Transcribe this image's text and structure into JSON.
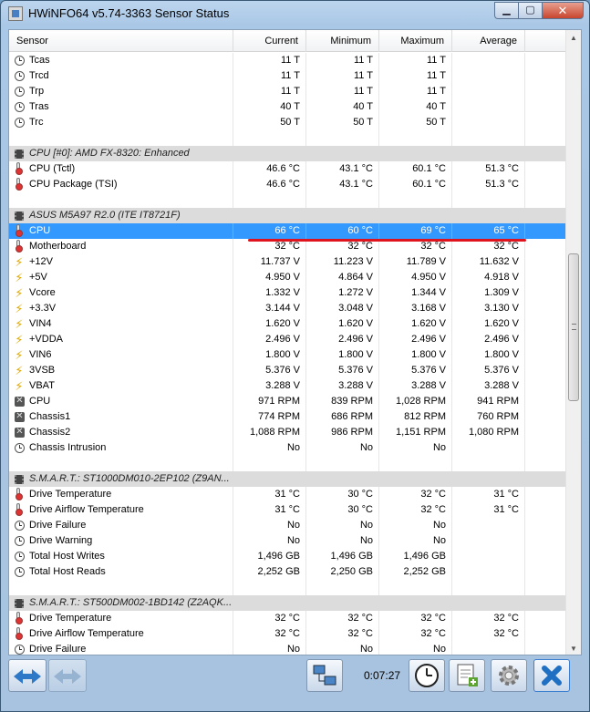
{
  "window": {
    "title": "HWiNFO64 v5.74-3363 Sensor Status",
    "caption_buttons": [
      "minimize",
      "maximize",
      "close"
    ]
  },
  "columns": [
    "Sensor",
    "Current",
    "Minimum",
    "Maximum",
    "Average"
  ],
  "rows": [
    {
      "type": "item",
      "icon": "clock-icon",
      "name": "Tcas",
      "cur": "11 T",
      "min": "11 T",
      "max": "11 T",
      "avg": ""
    },
    {
      "type": "item",
      "icon": "clock-icon",
      "name": "Trcd",
      "cur": "11 T",
      "min": "11 T",
      "max": "11 T",
      "avg": ""
    },
    {
      "type": "item",
      "icon": "clock-icon",
      "name": "Trp",
      "cur": "11 T",
      "min": "11 T",
      "max": "11 T",
      "avg": ""
    },
    {
      "type": "item",
      "icon": "clock-icon",
      "name": "Tras",
      "cur": "40 T",
      "min": "40 T",
      "max": "40 T",
      "avg": ""
    },
    {
      "type": "item",
      "icon": "clock-icon",
      "name": "Trc",
      "cur": "50 T",
      "min": "50 T",
      "max": "50 T",
      "avg": ""
    },
    {
      "type": "blank"
    },
    {
      "type": "group",
      "icon": "chip-icon",
      "name": "CPU [#0]: AMD FX-8320: Enhanced"
    },
    {
      "type": "item",
      "icon": "thermometer-icon",
      "name": "CPU (Tctl)",
      "cur": "46.6 °C",
      "min": "43.1 °C",
      "max": "60.1 °C",
      "avg": "51.3 °C"
    },
    {
      "type": "item",
      "icon": "thermometer-icon",
      "name": "CPU Package (TSI)",
      "cur": "46.6 °C",
      "min": "43.1 °C",
      "max": "60.1 °C",
      "avg": "51.3 °C"
    },
    {
      "type": "blank"
    },
    {
      "type": "group",
      "icon": "chip-icon",
      "name": "ASUS M5A97 R2.0 (ITE IT8721F)"
    },
    {
      "type": "item",
      "icon": "thermometer-icon",
      "name": "CPU",
      "cur": "66 °C",
      "min": "60 °C",
      "max": "69 °C",
      "avg": "65 °C",
      "selected": true
    },
    {
      "type": "item",
      "icon": "thermometer-icon",
      "name": "Motherboard",
      "cur": "32 °C",
      "min": "32 °C",
      "max": "32 °C",
      "avg": "32 °C"
    },
    {
      "type": "item",
      "icon": "bolt-icon",
      "name": "+12V",
      "cur": "11.737 V",
      "min": "11.223 V",
      "max": "11.789 V",
      "avg": "11.632 V"
    },
    {
      "type": "item",
      "icon": "bolt-icon",
      "name": "+5V",
      "cur": "4.950 V",
      "min": "4.864 V",
      "max": "4.950 V",
      "avg": "4.918 V"
    },
    {
      "type": "item",
      "icon": "bolt-icon",
      "name": "Vcore",
      "cur": "1.332 V",
      "min": "1.272 V",
      "max": "1.344 V",
      "avg": "1.309 V"
    },
    {
      "type": "item",
      "icon": "bolt-icon",
      "name": "+3.3V",
      "cur": "3.144 V",
      "min": "3.048 V",
      "max": "3.168 V",
      "avg": "3.130 V"
    },
    {
      "type": "item",
      "icon": "bolt-icon",
      "name": "VIN4",
      "cur": "1.620 V",
      "min": "1.620 V",
      "max": "1.620 V",
      "avg": "1.620 V"
    },
    {
      "type": "item",
      "icon": "bolt-icon",
      "name": "+VDDA",
      "cur": "2.496 V",
      "min": "2.496 V",
      "max": "2.496 V",
      "avg": "2.496 V"
    },
    {
      "type": "item",
      "icon": "bolt-icon",
      "name": "VIN6",
      "cur": "1.800 V",
      "min": "1.800 V",
      "max": "1.800 V",
      "avg": "1.800 V"
    },
    {
      "type": "item",
      "icon": "bolt-icon",
      "name": "3VSB",
      "cur": "5.376 V",
      "min": "5.376 V",
      "max": "5.376 V",
      "avg": "5.376 V"
    },
    {
      "type": "item",
      "icon": "bolt-icon",
      "name": "VBAT",
      "cur": "3.288 V",
      "min": "3.288 V",
      "max": "3.288 V",
      "avg": "3.288 V"
    },
    {
      "type": "item",
      "icon": "fan-icon",
      "name": "CPU",
      "cur": "971 RPM",
      "min": "839 RPM",
      "max": "1,028 RPM",
      "avg": "941 RPM"
    },
    {
      "type": "item",
      "icon": "fan-icon",
      "name": "Chassis1",
      "cur": "774 RPM",
      "min": "686 RPM",
      "max": "812 RPM",
      "avg": "760 RPM"
    },
    {
      "type": "item",
      "icon": "fan-icon",
      "name": "Chassis2",
      "cur": "1,088 RPM",
      "min": "986 RPM",
      "max": "1,151 RPM",
      "avg": "1,080 RPM"
    },
    {
      "type": "item",
      "icon": "clock-icon",
      "name": "Chassis Intrusion",
      "cur": "No",
      "min": "No",
      "max": "No",
      "avg": ""
    },
    {
      "type": "blank"
    },
    {
      "type": "group",
      "icon": "chip-icon",
      "name": "S.M.A.R.T.: ST1000DM010-2EP102 (Z9AN..."
    },
    {
      "type": "item",
      "icon": "thermometer-icon",
      "name": "Drive Temperature",
      "cur": "31 °C",
      "min": "30 °C",
      "max": "32 °C",
      "avg": "31 °C"
    },
    {
      "type": "item",
      "icon": "thermometer-icon",
      "name": "Drive Airflow Temperature",
      "cur": "31 °C",
      "min": "30 °C",
      "max": "32 °C",
      "avg": "31 °C"
    },
    {
      "type": "item",
      "icon": "clock-icon",
      "name": "Drive Failure",
      "cur": "No",
      "min": "No",
      "max": "No",
      "avg": ""
    },
    {
      "type": "item",
      "icon": "clock-icon",
      "name": "Drive Warning",
      "cur": "No",
      "min": "No",
      "max": "No",
      "avg": ""
    },
    {
      "type": "item",
      "icon": "clock-icon",
      "name": "Total Host Writes",
      "cur": "1,496 GB",
      "min": "1,496 GB",
      "max": "1,496 GB",
      "avg": ""
    },
    {
      "type": "item",
      "icon": "clock-icon",
      "name": "Total Host Reads",
      "cur": "2,252 GB",
      "min": "2,250 GB",
      "max": "2,252 GB",
      "avg": ""
    },
    {
      "type": "blank"
    },
    {
      "type": "group",
      "icon": "chip-icon",
      "name": "S.M.A.R.T.: ST500DM002-1BD142 (Z2AQK..."
    },
    {
      "type": "item",
      "icon": "thermometer-icon",
      "name": "Drive Temperature",
      "cur": "32 °C",
      "min": "32 °C",
      "max": "32 °C",
      "avg": "32 °C"
    },
    {
      "type": "item",
      "icon": "thermometer-icon",
      "name": "Drive Airflow Temperature",
      "cur": "32 °C",
      "min": "32 °C",
      "max": "32 °C",
      "avg": "32 °C"
    },
    {
      "type": "item",
      "icon": "clock-icon",
      "name": "Drive Failure",
      "cur": "No",
      "min": "No",
      "max": "No",
      "avg": ""
    }
  ],
  "toolbar": {
    "timer": "0:07:27",
    "buttons": [
      "nav-back-icon",
      "nav-forward-icon",
      "network-icon",
      "clock-icon",
      "add-report-icon",
      "gear-icon",
      "close-icon"
    ]
  }
}
